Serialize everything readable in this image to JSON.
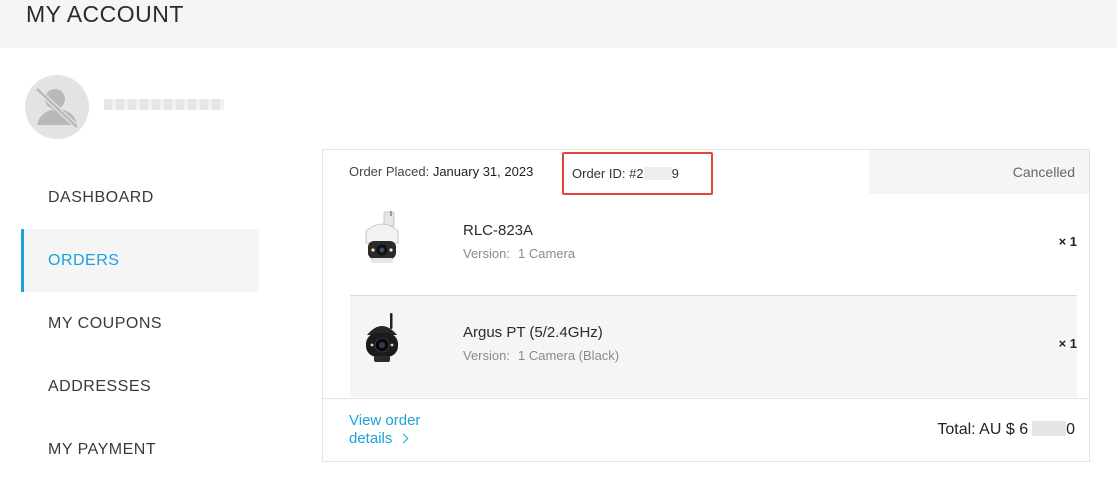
{
  "header": {
    "title": "MY ACCOUNT"
  },
  "profile": {
    "avatar_icon": "user-hidden-icon"
  },
  "sidebar": {
    "items": [
      {
        "label": "DASHBOARD"
      },
      {
        "label": "ORDERS"
      },
      {
        "label": "MY COUPONS"
      },
      {
        "label": "ADDRESSES"
      },
      {
        "label": "MY PAYMENT"
      }
    ],
    "active_index": 1
  },
  "order": {
    "placed_label": "Order Placed:",
    "placed_date": "January 31, 2023",
    "id_label": "Order ID:",
    "id_prefix": "#2",
    "id_suffix": "9",
    "status": "Cancelled",
    "items": [
      {
        "name": "RLC-823A",
        "version_label": "Version:",
        "version": "1 Camera",
        "qty": "× 1",
        "thumb_icon": "white-ptz-camera-icon"
      },
      {
        "name": "Argus PT (5/2.4GHz)",
        "version_label": "Version:",
        "version": "1 Camera (Black)",
        "qty": "× 1",
        "thumb_icon": "black-pt-camera-icon"
      }
    ],
    "view_details_label": "View order details",
    "total_label": "Total: AU $ 6",
    "total_suffix": "0"
  },
  "colors": {
    "accent": "#1aa3d9",
    "highlight_box": "#e0463c",
    "band": "#f5f5f5"
  }
}
